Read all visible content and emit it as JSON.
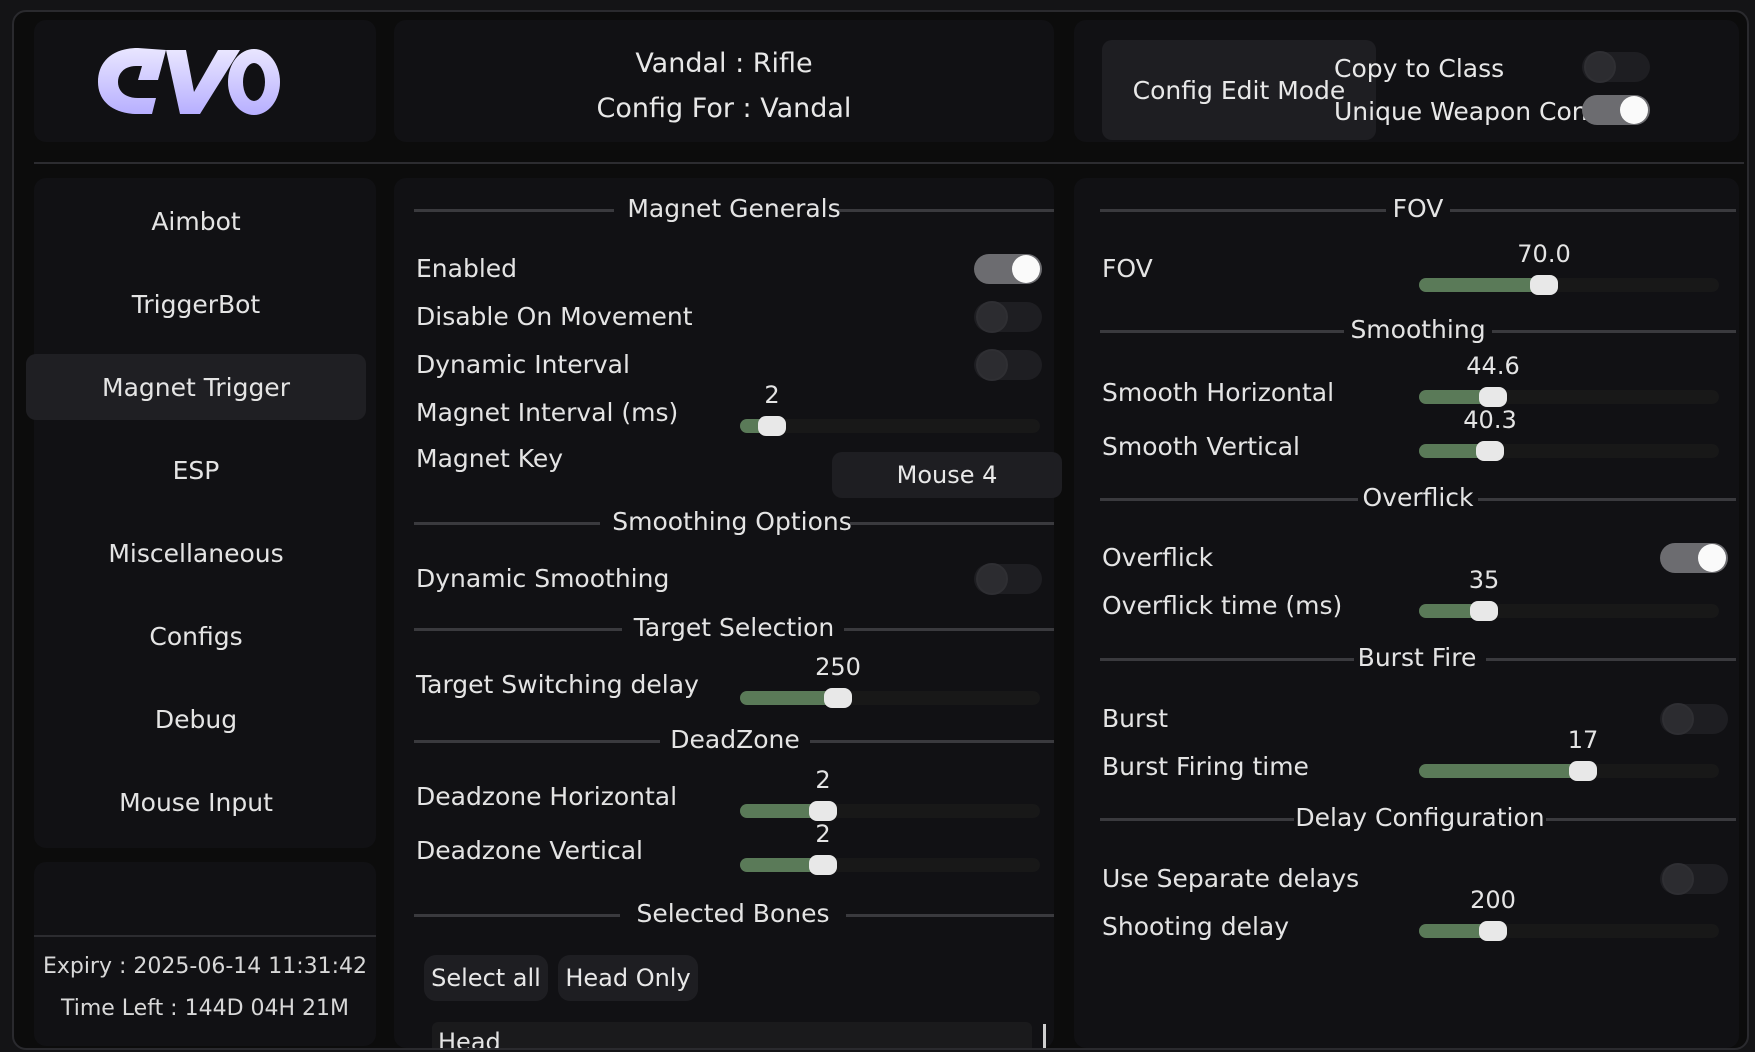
{
  "header": {
    "logo_text": "evo",
    "weapon_line": "Vandal : Rifle",
    "config_line": "Config For : Vandal",
    "config_edit_mode": "Config Edit Mode",
    "copy_to_class": {
      "label": "Copy to Class",
      "enabled": false
    },
    "unique_weapon_config": {
      "label": "Unique Weapon Config",
      "enabled": true
    }
  },
  "sidebar": {
    "items": [
      {
        "label": "Aimbot",
        "active": false
      },
      {
        "label": "TriggerBot",
        "active": false
      },
      {
        "label": "Magnet Trigger",
        "active": true
      },
      {
        "label": "ESP",
        "active": false
      },
      {
        "label": "Miscellaneous",
        "active": false
      },
      {
        "label": "Configs",
        "active": false
      },
      {
        "label": "Debug",
        "active": false
      },
      {
        "label": "Mouse Input",
        "active": false
      }
    ]
  },
  "license": {
    "expiry": "Expiry : 2025-06-14 11:31:42",
    "time_left": "Time Left : 144D 04H 21M"
  },
  "middle": {
    "magnet_generals": "Magnet Generals",
    "enabled": {
      "label": "Enabled",
      "value": true
    },
    "disable_on_movement": {
      "label": "Disable On Movement",
      "value": false
    },
    "dynamic_interval": {
      "label": "Dynamic Interval",
      "value": false
    },
    "magnet_interval": {
      "label": "Magnet Interval (ms)",
      "value": "2",
      "fraction": 0.06
    },
    "magnet_key": {
      "label": "Magnet Key",
      "value": "Mouse 4"
    },
    "smoothing_options": "Smoothing Options",
    "dynamic_smoothing": {
      "label": "Dynamic Smoothing",
      "value": false
    },
    "target_selection": "Target Selection",
    "target_switching_delay": {
      "label": "Target Switching delay",
      "value": "250",
      "fraction": 0.28
    },
    "deadzone": "DeadZone",
    "deadzone_horizontal": {
      "label": "Deadzone Horizontal",
      "value": "2",
      "fraction": 0.23
    },
    "deadzone_vertical": {
      "label": "Deadzone Vertical",
      "value": "2",
      "fraction": 0.23
    },
    "selected_bones": "Selected Bones",
    "select_all": "Select all",
    "head_only": "Head Only",
    "bones_list": [
      "Head"
    ]
  },
  "right": {
    "fov_section": "FOV",
    "fov": {
      "label": "FOV",
      "value": "70.0",
      "fraction": 0.37
    },
    "smoothing_section": "Smoothing",
    "smooth_horizontal": {
      "label": "Smooth Horizontal",
      "value": "44.6",
      "fraction": 0.2
    },
    "smooth_vertical": {
      "label": "Smooth Vertical",
      "value": "40.3",
      "fraction": 0.19
    },
    "overflick_section": "Overflick",
    "overflick": {
      "label": "Overflick",
      "value": true
    },
    "overflick_time": {
      "label": "Overflick time (ms)",
      "value": "35",
      "fraction": 0.17
    },
    "burst_section": "Burst Fire",
    "burst": {
      "label": "Burst",
      "value": false
    },
    "burst_firing_time": {
      "label": "Burst Firing time",
      "value": "17",
      "fraction": 0.5
    },
    "delay_section": "Delay Configuration",
    "use_separate_delays": {
      "label": "Use Separate delays",
      "value": false
    },
    "shooting_delay": {
      "label": "Shooting delay",
      "value": "200",
      "fraction": 0.2
    }
  },
  "colors": {
    "background": "#0c0c0c",
    "panel": "#111114",
    "accent_fill": "#5a7a58",
    "toggle_on": "#6c6c70",
    "knob_on": "#fafafa"
  }
}
